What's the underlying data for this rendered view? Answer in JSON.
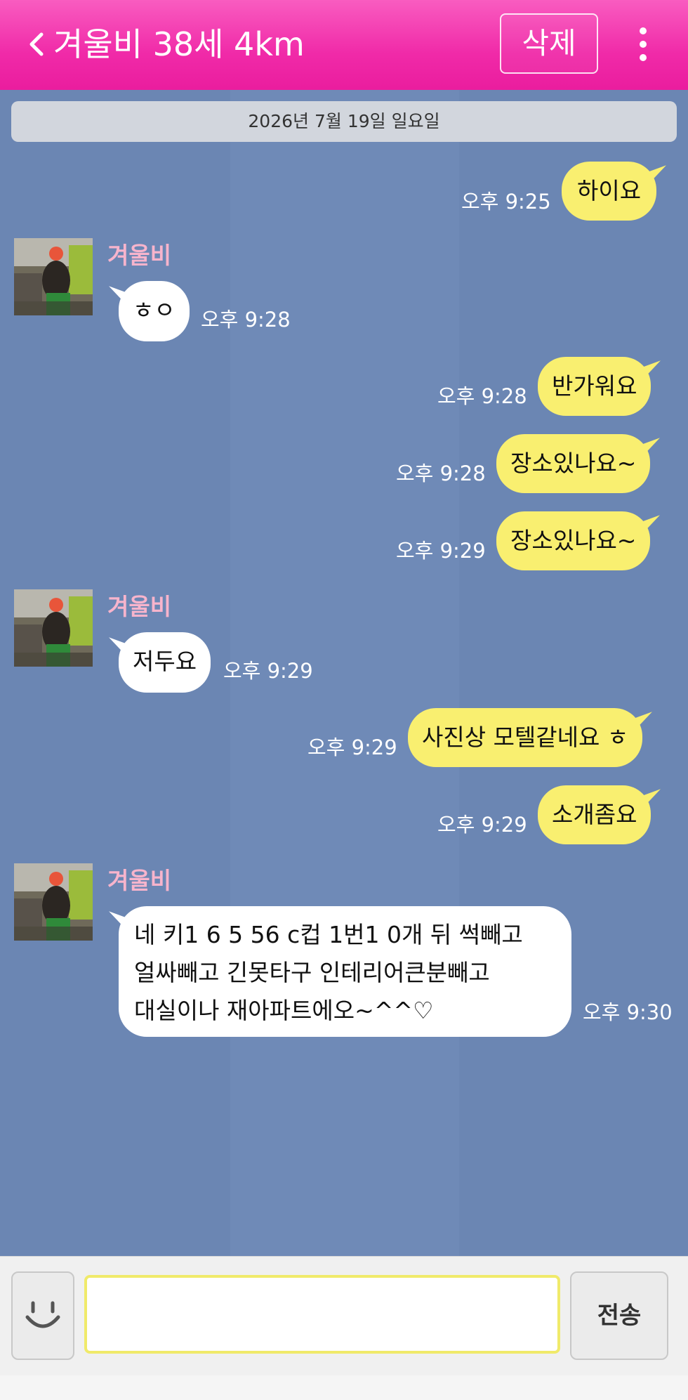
{
  "header": {
    "title": "겨울비 38세 4km",
    "delete_label": "삭제"
  },
  "chat": {
    "date": "2026년 7월 19일 일요일",
    "messages": [
      {
        "from": "me",
        "text": "하이요",
        "time": "오후 9:25"
      },
      {
        "from": "them",
        "sender": "겨울비",
        "text": "ㅎㅇ",
        "time": "오후 9:28"
      },
      {
        "from": "me",
        "text": "반가워요",
        "time": "오후 9:28"
      },
      {
        "from": "me",
        "text": "장소있나요~",
        "time": "오후 9:28"
      },
      {
        "from": "me",
        "text": "장소있나요~",
        "time": "오후 9:29"
      },
      {
        "from": "them",
        "sender": "겨울비",
        "text": "저두요",
        "time": "오후 9:29"
      },
      {
        "from": "me",
        "text": "사진상 모텔같네요 ㅎ",
        "time": "오후 9:29"
      },
      {
        "from": "me",
        "text": "소개좀요",
        "time": "오후 9:29"
      },
      {
        "from": "them",
        "sender": "겨울비",
        "lines": [
          "네 키1 6 5 56 c컵 1번1  0개 뒤 썩빼고",
          "얼싸빼고 긴못타구  인테리어큰분빼고",
          "대실이나 재아파트에오~^^♡"
        ],
        "time": "오후 9:30"
      }
    ]
  },
  "input": {
    "value": "",
    "placeholder": "",
    "send_label": "전송"
  },
  "colors": {
    "header": "#f02aa8",
    "chat_bg": "#6b86b3",
    "my_bubble": "#f9ef70",
    "their_bubble": "#ffffff",
    "sender_name": "#f7b4cc"
  },
  "icons": {
    "back": "chevron-left-icon",
    "more": "more-vertical-icon",
    "emoji": "smiley-icon"
  }
}
